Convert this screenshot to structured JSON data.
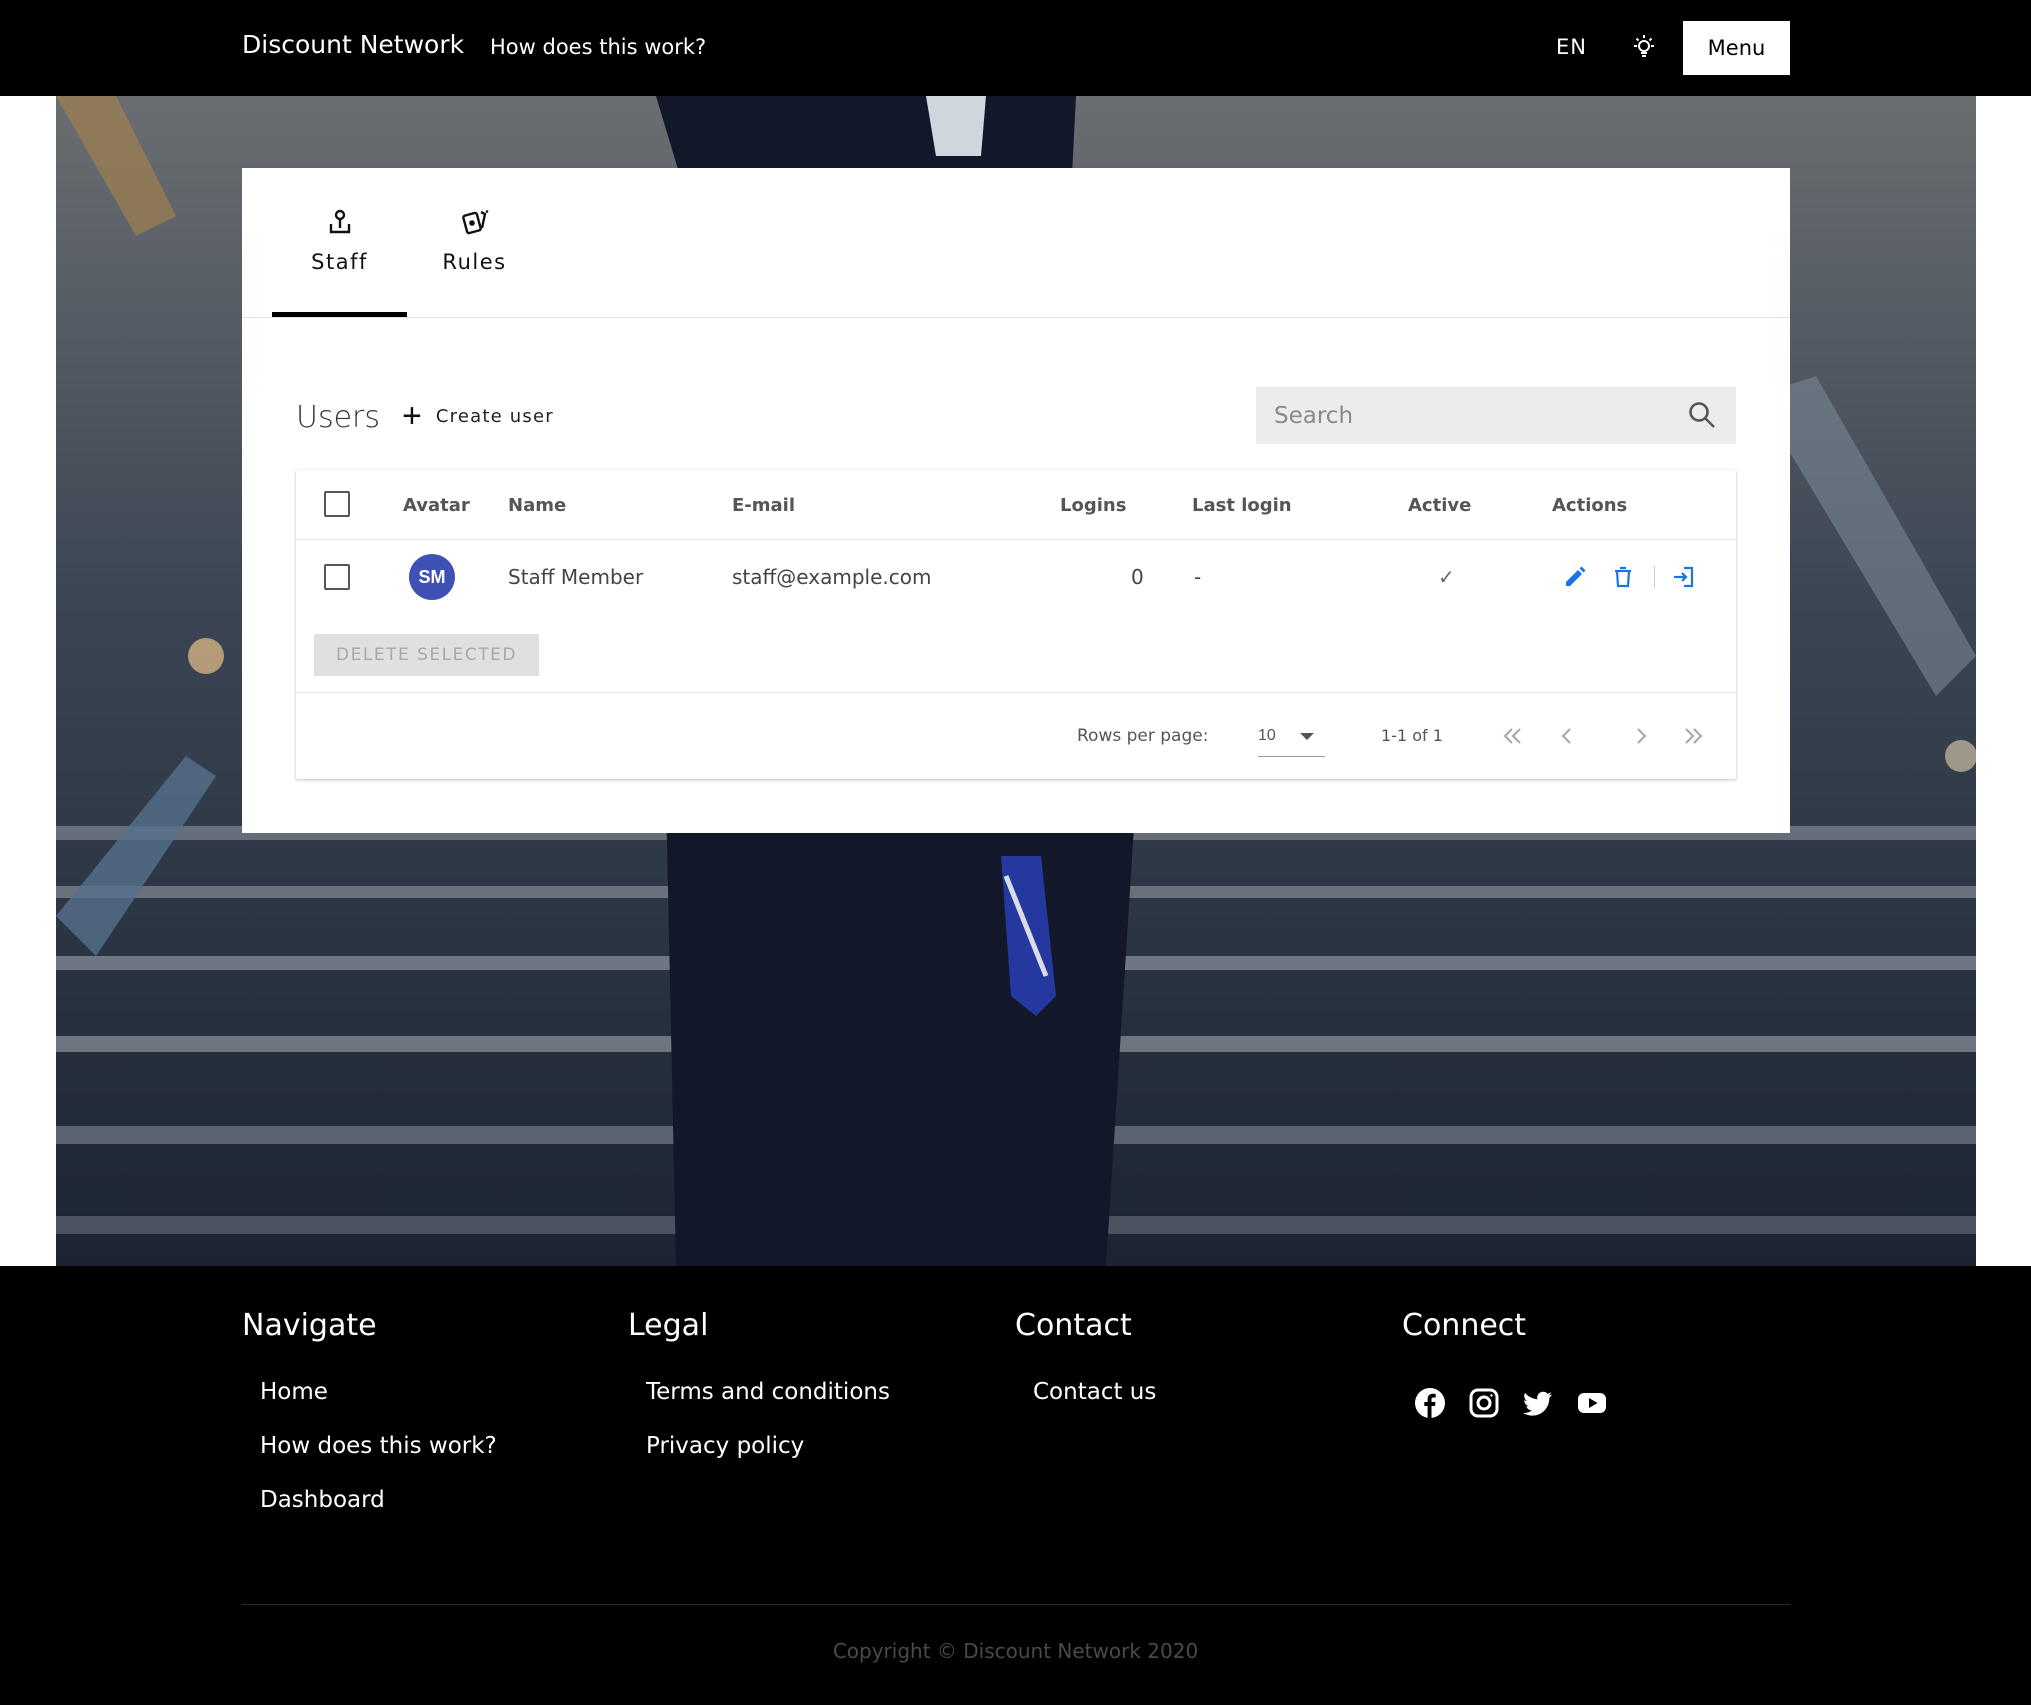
{
  "header": {
    "brand": "Discount Network",
    "how_link": "How does this work?",
    "language": "EN",
    "theme_icon": "lightbulb-icon",
    "menu_label": "Menu"
  },
  "tabs": [
    {
      "label": "Staff",
      "icon": "staff-icon",
      "active": true
    },
    {
      "label": "Rules",
      "icon": "rules-icon",
      "active": false
    }
  ],
  "users": {
    "title": "Users",
    "create_label": "Create user",
    "search_placeholder": "Search",
    "columns": [
      "Avatar",
      "Name",
      "E-mail",
      "Logins",
      "Last login",
      "Active",
      "Actions"
    ],
    "rows": [
      {
        "initials": "SM",
        "name": "Staff Member",
        "email": "staff@example.com",
        "logins": "0",
        "last_login": "-",
        "active": "✓"
      }
    ],
    "delete_selected": "DELETE SELECTED",
    "rows_per_page_label": "Rows per page:",
    "rows_per_page": "10",
    "range": "1-1 of 1"
  },
  "colors": {
    "accent": "#1a73e8",
    "avatar": "#3f51b5"
  },
  "footer": {
    "navigate": {
      "title": "Navigate",
      "links": [
        "Home",
        "How does this work?",
        "Dashboard"
      ]
    },
    "legal": {
      "title": "Legal",
      "links": [
        "Terms and conditions",
        "Privacy policy"
      ]
    },
    "contact": {
      "title": "Contact",
      "links": [
        "Contact us"
      ]
    },
    "connect": {
      "title": "Connect",
      "icons": [
        "facebook-icon",
        "instagram-icon",
        "twitter-icon",
        "youtube-icon"
      ]
    },
    "copyright": "Copyright © Discount Network 2020"
  }
}
